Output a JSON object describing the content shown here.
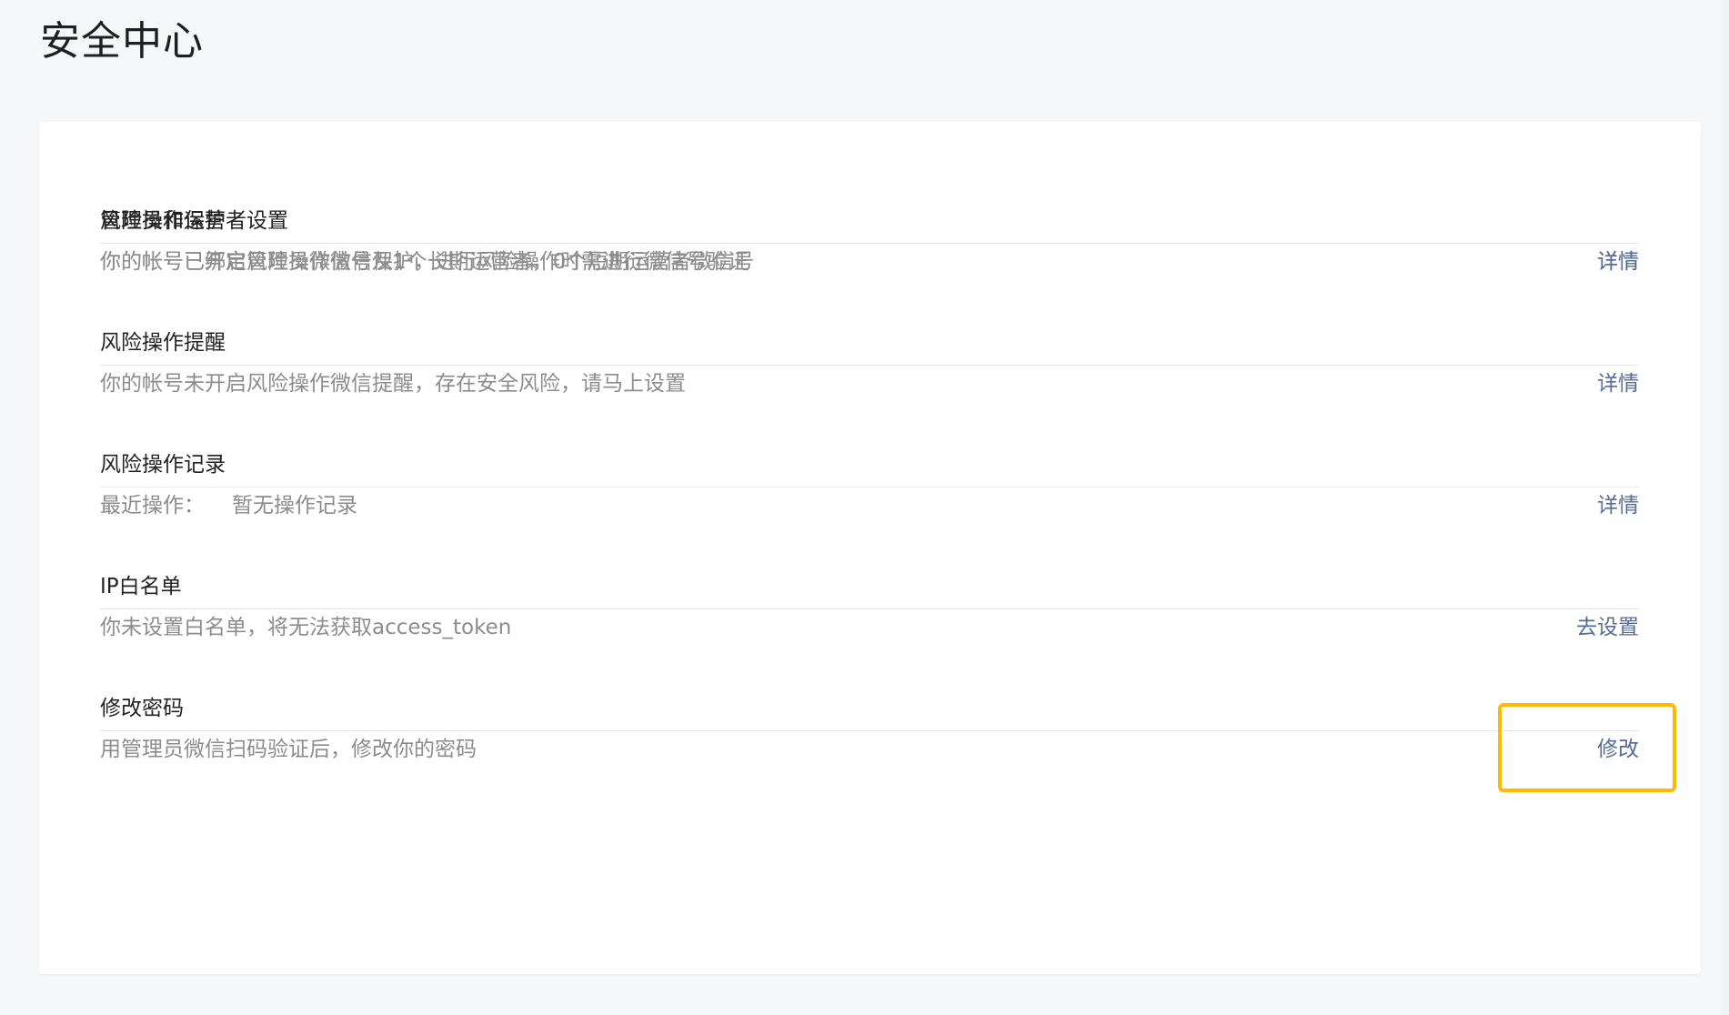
{
  "page": {
    "title": "安全中心"
  },
  "rows": [
    {
      "title": "管理员和运营者设置",
      "desc": "你的帐号已绑定管理员微信号及1个长期运营者，0个短期运营者微信号",
      "action": "详情"
    },
    {
      "title": "风险操作保护",
      "desc": "你的帐号已开启风险操作微信保护，进行风险操作时需进行微信号验证",
      "action": "详情"
    },
    {
      "title": "风险操作提醒",
      "desc": "你的帐号未开启风险操作微信提醒，存在安全风险，请马上设置",
      "action": "详情"
    },
    {
      "title": "风险操作记录",
      "desc_label": "最近操作：",
      "desc_value": "暂无操作记录",
      "action": "详情"
    },
    {
      "title": "IP白名单",
      "desc": "你未设置白名单，将无法获取access_token",
      "action": "去设置"
    },
    {
      "title": "修改密码",
      "desc": "用管理员微信扫码验证后，修改你的密码",
      "action": "修改"
    }
  ],
  "colors": {
    "link": "#576b95",
    "highlight": "#ffba00",
    "title_text": "#222222",
    "desc_text": "#8c8c8c",
    "background": "#f6f7f9"
  }
}
